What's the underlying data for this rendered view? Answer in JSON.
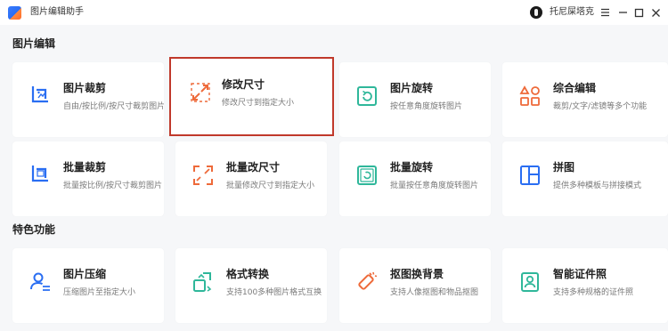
{
  "titlebar": {
    "title": "图片编辑助手",
    "user_name": "托尼屎塔克"
  },
  "colors": {
    "accent_blue": "#2a6ef2",
    "accent_orange": "#ee6a3a",
    "accent_teal": "#2fb79a",
    "selection_red": "#c0392b"
  },
  "sections": {
    "edit": "图片编辑",
    "special": "特色功能"
  },
  "cards": [
    {
      "title": "图片裁剪",
      "desc": "自由/按比例/按尺寸裁剪图片",
      "icon": "crop-icon"
    },
    {
      "title": "修改尺寸",
      "desc": "修改尺寸到指定大小",
      "icon": "resize-icon"
    },
    {
      "title": "图片旋转",
      "desc": "按任意角度旋转图片",
      "icon": "rotate-icon"
    },
    {
      "title": "综合编辑",
      "desc": "裁剪/文字/滤镜等多个功能",
      "icon": "shapes-icon"
    },
    {
      "title": "批量裁剪",
      "desc": "批量按比例/按尺寸裁剪图片",
      "icon": "batch-crop-icon"
    },
    {
      "title": "批量改尺寸",
      "desc": "批量修改尺寸到指定大小",
      "icon": "batch-resize-icon"
    },
    {
      "title": "批量旋转",
      "desc": "批量按任意角度旋转图片",
      "icon": "batch-rotate-icon"
    },
    {
      "title": "拼图",
      "desc": "提供多种模板与拼接模式",
      "icon": "collage-icon"
    },
    {
      "title": "图片压缩",
      "desc": "压缩图片至指定大小",
      "icon": "compress-icon"
    },
    {
      "title": "格式转换",
      "desc": "支持100多种图片格式互换",
      "icon": "convert-icon"
    },
    {
      "title": "抠图换背景",
      "desc": "支持人像抠图和物品抠图",
      "icon": "cutout-icon"
    },
    {
      "title": "智能证件照",
      "desc": "支持多种规格的证件照",
      "icon": "id-photo-icon"
    }
  ]
}
